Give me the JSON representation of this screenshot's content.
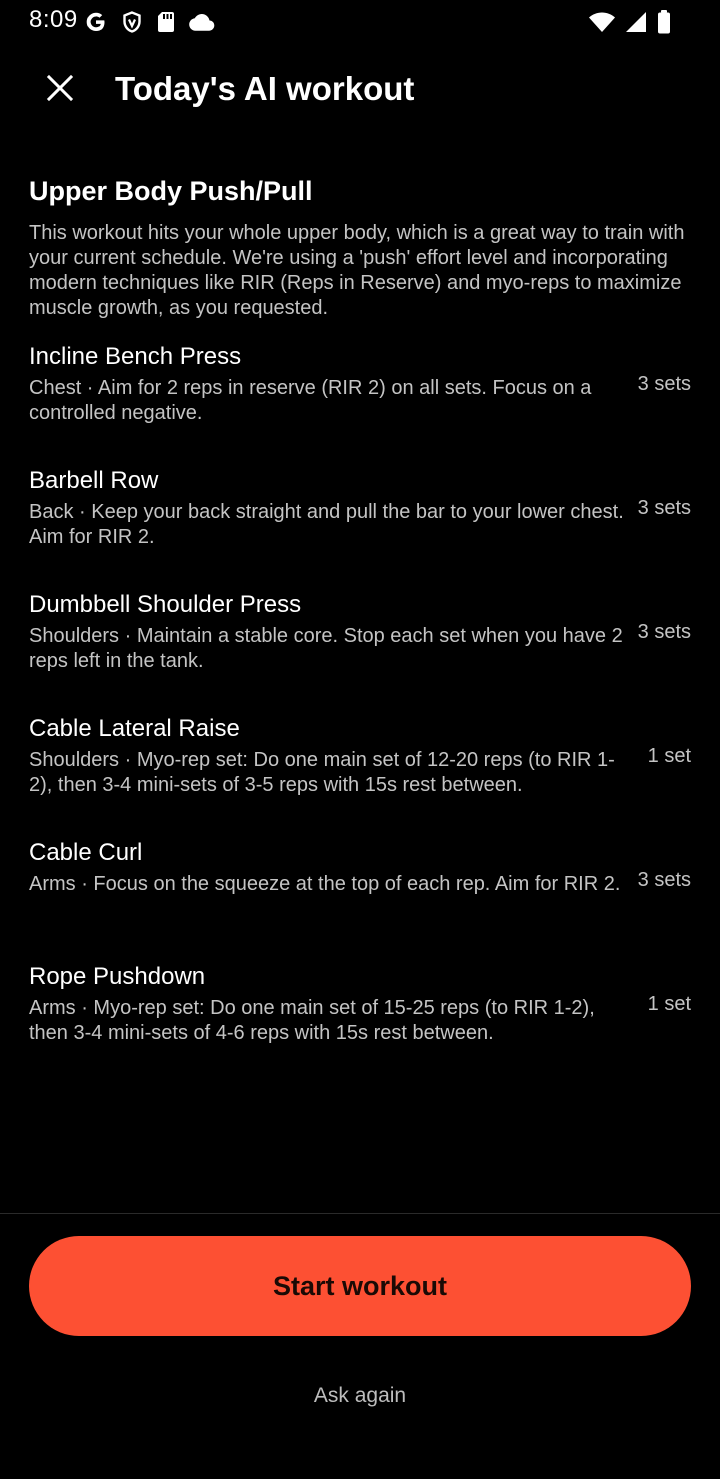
{
  "status_bar": {
    "time": "8:09",
    "left_icons": [
      "google-icon",
      "shield-icon",
      "sd-card-icon",
      "cloud-icon"
    ],
    "right_icons": [
      "wifi-icon",
      "cell-signal-icon",
      "battery-icon"
    ]
  },
  "header": {
    "close_icon": "close-icon",
    "title": "Today's AI workout"
  },
  "workout": {
    "name": "Upper Body Push/Pull",
    "description": "This workout hits your whole upper body, which is a great way to train with your current schedule. We're using a 'push' effort level and incorporating modern techniques like RIR (Reps in Reserve) and myo-reps to maximize muscle growth, as you requested."
  },
  "exercises": [
    {
      "name": "Incline Bench Press",
      "detail": "Chest · Aim for 2 reps in reserve (RIR 2) on all sets. Focus on a controlled negative.",
      "sets": "3 sets"
    },
    {
      "name": "Barbell Row",
      "detail": "Back · Keep your back straight and pull the bar to your lower chest. Aim for RIR 2.",
      "sets": "3 sets"
    },
    {
      "name": "Dumbbell Shoulder Press",
      "detail": "Shoulders · Maintain a stable core. Stop each set when you have 2 reps left in the tank.",
      "sets": "3 sets"
    },
    {
      "name": "Cable Lateral Raise",
      "detail": "Shoulders · Myo-rep set: Do one main set of 12-20 reps (to RIR 1-2), then 3-4 mini-sets of 3-5 reps with 15s rest between.",
      "sets": "1 set"
    },
    {
      "name": "Cable Curl",
      "detail": "Arms · Focus on the squeeze at the top of each rep. Aim for RIR 2.",
      "sets": "3 sets"
    },
    {
      "name": "Rope Pushdown",
      "detail": "Arms · Myo-rep set: Do one main set of 15-25 reps (to RIR 1-2), then 3-4 mini-sets of 4-6 reps with 15s rest between.",
      "sets": "1 set"
    }
  ],
  "footer": {
    "start_label": "Start workout",
    "ask_again_label": "Ask again"
  },
  "colors": {
    "background": "#000000",
    "accent": "#fd5033",
    "primary_text": "#ffffff",
    "secondary_text": "#c4c4c4"
  }
}
